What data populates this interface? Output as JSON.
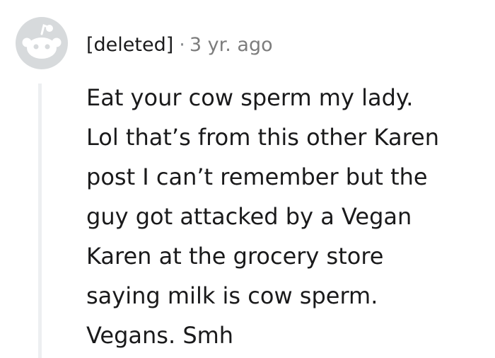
{
  "comment": {
    "author": "[deleted]",
    "separator": "·",
    "timestamp": "3 yr. ago",
    "avatar_icon": "snoo-avatar-icon",
    "text": "Eat your cow sperm my lady.\nLol that’s from this other Karen\npost I can’t remember but the\nguy got attacked by a Vegan\nKaren at the grocery store\nsaying milk is cow sperm.\nVegans. Smh"
  },
  "colors": {
    "text": "#1a1a1b",
    "meta": "#7c7c7c",
    "thread_line": "#edeff1",
    "avatar": "#d7dadc"
  }
}
